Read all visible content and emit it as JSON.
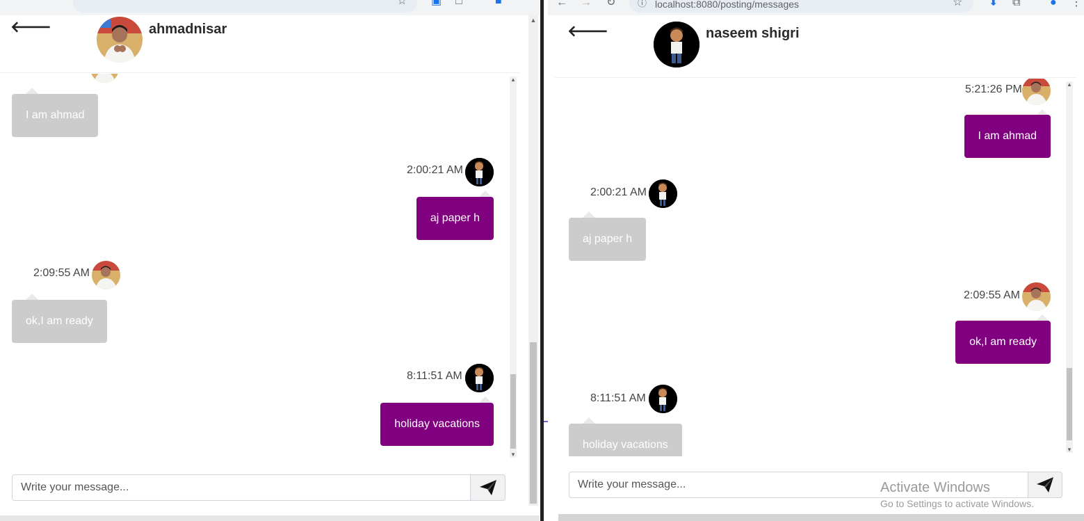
{
  "left_window": {
    "header": {
      "name": "ahmadnisar"
    },
    "messages": [
      {
        "text": "I am ahmad",
        "side": "recv"
      },
      {
        "time": "2:00:21 AM",
        "text": "aj paper h",
        "side": "sent"
      },
      {
        "time": "2:09:55 AM",
        "text": "ok,I am ready",
        "side": "recv"
      },
      {
        "time": "8:11:51 AM",
        "text": "holiday vacations",
        "side": "sent"
      }
    ],
    "input": {
      "placeholder": "Write your message..."
    }
  },
  "right_window": {
    "browser": {
      "url": "localhost:8080/posting/messages"
    },
    "header": {
      "name": "naseem shigri"
    },
    "messages": [
      {
        "time": "5:21:26 PM",
        "text": "I am ahmad",
        "side": "sent"
      },
      {
        "time": "2:00:21 AM",
        "text": "aj paper h",
        "side": "recv"
      },
      {
        "time": "2:09:55 AM",
        "text": "ok,I am ready",
        "side": "sent"
      },
      {
        "time": "8:11:51 AM",
        "text": "holiday vacations",
        "side": "recv"
      }
    ],
    "input": {
      "placeholder": "Write your message..."
    },
    "watermark": {
      "title": "Activate Windows",
      "subtitle": "Go to Settings to activate Windows."
    }
  },
  "colors": {
    "sent_bubble": "#800080",
    "received_bubble": "#cccccc"
  }
}
